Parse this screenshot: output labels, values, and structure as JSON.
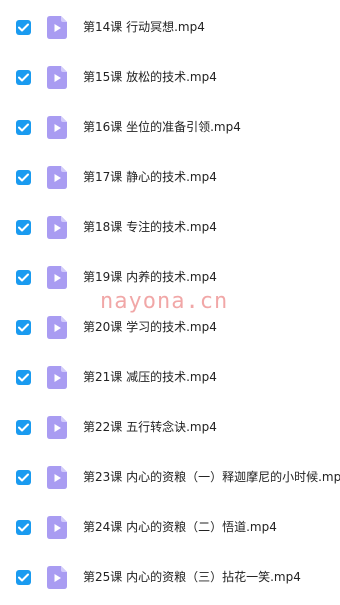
{
  "files": [
    {
      "name": "第14课 行动冥想.mp4",
      "checked": true
    },
    {
      "name": "第15课 放松的技术.mp4",
      "checked": true
    },
    {
      "name": "第16课 坐位的准备引领.mp4",
      "checked": true
    },
    {
      "name": "第17课 静心的技术.mp4",
      "checked": true
    },
    {
      "name": "第18课 专注的技术.mp4",
      "checked": true
    },
    {
      "name": "第19课 内养的技术.mp4",
      "checked": true
    },
    {
      "name": "第20课 学习的技术.mp4",
      "checked": true
    },
    {
      "name": "第21课 减压的技术.mp4",
      "checked": true
    },
    {
      "name": "第22课 五行转念诀.mp4",
      "checked": true
    },
    {
      "name": "第23课 内心的资粮（一）释迦摩尼的小时候.mp4",
      "checked": true
    },
    {
      "name": "第24课 内心的资粮（二）悟道.mp4",
      "checked": true
    },
    {
      "name": "第25课 内心的资粮（三）拈花一笑.mp4",
      "checked": true
    }
  ],
  "watermark": "nayona.cn",
  "colors": {
    "checkbox": "#1a9bf0",
    "video_icon": "#a99cf2",
    "video_icon_fold": "#d3ccfa",
    "text": "#222222"
  },
  "icons": {
    "checkbox": "checkmark-icon",
    "file": "video-file-icon"
  }
}
